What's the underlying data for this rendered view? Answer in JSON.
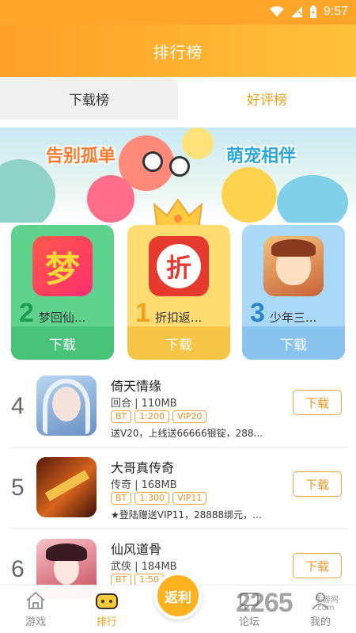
{
  "status": {
    "time": "9:57"
  },
  "header": {
    "title": "排行榜"
  },
  "tabs": [
    {
      "label": "下载榜",
      "active": true
    },
    {
      "label": "好评榜",
      "active": false
    }
  ],
  "banner": {
    "left_text": "告别孤单",
    "right_text": "萌宠相伴"
  },
  "top3": [
    {
      "rank": "2",
      "name": "梦回仙...",
      "download_label": "下载",
      "icon_glyph": "梦",
      "color": "#49c27a"
    },
    {
      "rank": "1",
      "name": "折扣返...",
      "download_label": "下载",
      "icon_glyph": "折",
      "color": "#f7c545"
    },
    {
      "rank": "3",
      "name": "少年三...",
      "download_label": "下载",
      "icon_glyph": "",
      "color": "#88c4ee"
    }
  ],
  "list": [
    {
      "rank": "4",
      "name": "倚天情缘",
      "meta": "回合 | 110MB",
      "tags": [
        "BT",
        "1:200",
        "VIP20"
      ],
      "desc": "送V20，上线送66666银锭，288...",
      "download_label": "下载"
    },
    {
      "rank": "5",
      "name": "大哥真传奇",
      "meta": "传奇 | 168MB",
      "tags": [
        "BT",
        "1:300",
        "VIP11"
      ],
      "desc": "★登陆赠送VIP11，28888绑元，...",
      "download_label": "下载"
    },
    {
      "rank": "6",
      "name": "仙风道骨",
      "meta": "武侠 | 184MB",
      "tags": [
        "BT",
        "1:50",
        "13"
      ],
      "desc": "",
      "download_label": "下载"
    }
  ],
  "bottom_nav": [
    {
      "label": "游戏",
      "active": false
    },
    {
      "label": "排行",
      "active": true
    },
    {
      "label": "论坛",
      "active": false
    },
    {
      "label": "我的",
      "active": false
    }
  ],
  "fab": {
    "label": "返利"
  },
  "watermark": {
    "main": "2265",
    "sub1": "手游网",
    "sub2": ".com"
  },
  "colors": {
    "accent": "#ffa52a",
    "tab_inactive_text": "#f5a21b"
  }
}
